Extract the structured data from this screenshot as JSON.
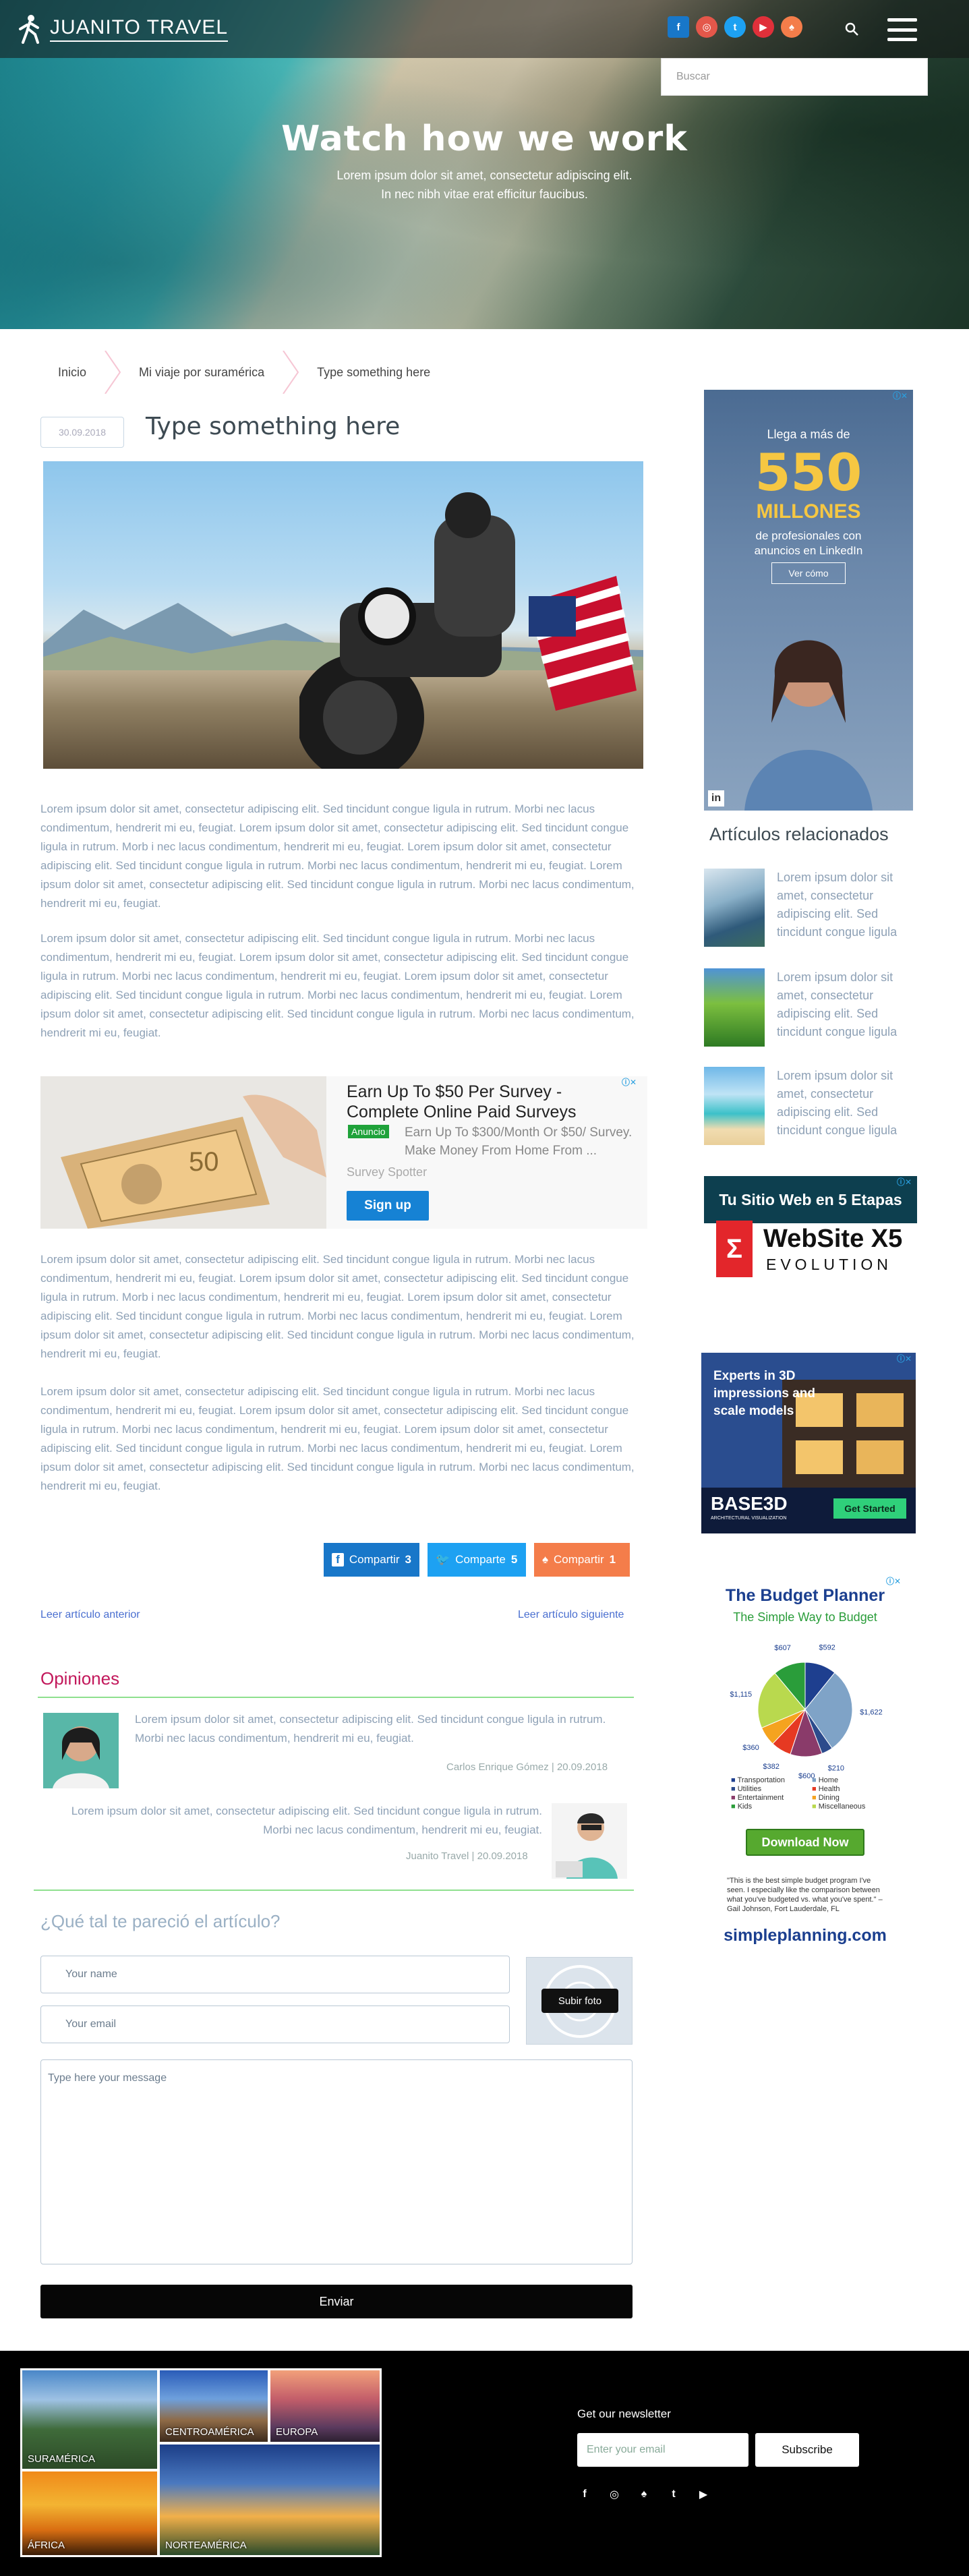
{
  "header": {
    "logo_text": "JUANITO TRAVEL",
    "search_placeholder": "Buscar"
  },
  "hero": {
    "title": "Watch how we work",
    "subtitle_line1": "Lorem ipsum dolor sit amet, consectetur adipiscing elit.",
    "subtitle_line2": "In nec nibh vitae erat efficitur faucibus."
  },
  "breadcrumb": [
    "Inicio",
    "Mi viaje por suramérica",
    "Type something here"
  ],
  "post": {
    "date": "30.09.2018",
    "title": "Type something here",
    "paragraphs": [
      "Lorem ipsum dolor sit amet, consectetur adipiscing elit. Sed tincidunt congue ligula in rutrum. Morbi nec lacus condimentum, hendrerit mi eu, feugiat. Lorem ipsum dolor sit amet, consectetur adipiscing elit. Sed tincidunt congue ligula in rutrum. Morb i nec lacus condimentum, hendrerit mi eu, feugiat. Lorem ipsum dolor sit amet, consectetur adipiscing elit. Sed tincidunt congue ligula in rutrum. Morbi nec lacus condimentum, hendrerit mi eu, feugiat. Lorem ipsum dolor sit amet, consectetur adipiscing elit. Sed tincidunt congue ligula in rutrum. Morbi nec lacus condimentum, hendrerit mi eu, feugiat.",
      "Lorem ipsum dolor sit amet, consectetur adipiscing elit. Sed tincidunt congue ligula in rutrum. Morbi nec lacus condimentum, hendrerit mi eu, feugiat. Lorem ipsum dolor sit amet, consectetur adipiscing elit. Sed tincidunt congue ligula in rutrum. Morbi nec lacus condimentum, hendrerit mi eu, feugiat. Lorem ipsum dolor sit amet, consectetur adipiscing elit. Sed tincidunt congue ligula in rutrum. Morbi nec lacus condimentum, hendrerit mi eu, feugiat. Lorem ipsum dolor sit amet, consectetur adipiscing elit. Sed tincidunt congue ligula in rutrum. Morbi nec lacus condimentum, hendrerit mi eu, feugiat.",
      "Lorem ipsum dolor sit amet, consectetur adipiscing elit. Sed tincidunt congue ligula in rutrum. Morbi nec lacus condimentum, hendrerit mi eu, feugiat. Lorem ipsum dolor sit amet, consectetur adipiscing elit. Sed tincidunt congue ligula in rutrum. Morb i nec lacus condimentum, hendrerit mi eu, feugiat. Lorem ipsum dolor sit amet, consectetur adipiscing elit. Sed tincidunt congue ligula in rutrum. Morbi nec lacus condimentum, hendrerit mi eu, feugiat. Lorem ipsum dolor sit amet, consectetur adipiscing elit. Sed tincidunt congue ligula in rutrum. Morbi nec lacus condimentum, hendrerit mi eu, feugiat.",
      "Lorem ipsum dolor sit amet, consectetur adipiscing elit. Sed tincidunt congue ligula in rutrum. Morbi nec lacus condimentum, hendrerit mi eu, feugiat. Lorem ipsum dolor sit amet, consectetur adipiscing elit. Sed tincidunt congue ligula in rutrum. Morbi nec lacus condimentum, hendrerit mi eu, feugiat. Lorem ipsum dolor sit amet, consectetur adipiscing elit. Sed tincidunt congue ligula in rutrum. Morbi nec lacus condimentum, hendrerit mi eu, feugiat. Lorem ipsum dolor sit amet, consectetur adipiscing elit. Sed tincidunt congue ligula in rutrum. Morbi nec lacus condimentum, hendrerit mi eu, feugiat."
    ]
  },
  "ad_inline": {
    "title": "Earn Up To $50 Per Survey - Complete Online Paid Surveys",
    "tag": "Anuncio",
    "description": "Earn Up To $300/Month Or $50/ Survey. Make Money From Home From ...",
    "brand": "Survey Spotter",
    "cta": "Sign up"
  },
  "share": {
    "facebook_label": "Compartir",
    "facebook_count": "3",
    "twitter_label": "Comparte",
    "twitter_count": "5",
    "snapchat_label": "Compartir",
    "snapchat_count": "1"
  },
  "article_nav": {
    "prev": "Leer artículo anterior",
    "next": "Leer artículo siguiente"
  },
  "comments": {
    "title": "Opiniones",
    "items": [
      {
        "text": "Lorem ipsum dolor sit amet, consectetur adipiscing elit. Sed tincidunt congue ligula in rutrum. Morbi nec lacus condimentum, hendrerit mi eu, feugiat.",
        "meta": "Carlos Enrique Gómez | 20.09.2018"
      },
      {
        "text": "Lorem ipsum dolor sit amet, consectetur adipiscing elit. Sed tincidunt congue ligula in rutrum. Morbi nec lacus condimentum, hendrerit mi eu, feugiat.",
        "meta": "Juanito Travel | 20.09.2018"
      }
    ]
  },
  "form": {
    "title": "¿Qué tal te pareció el artículo?",
    "name_placeholder": "Your name",
    "email_placeholder": "Your email",
    "message_placeholder": "Type here your message",
    "photo_button": "Subir foto",
    "submit": "Enviar"
  },
  "sidebar": {
    "ad_linkedin": {
      "line1": "Llega a más de",
      "number": "550",
      "line2": "MILLONES",
      "line3": "de profesionales con anuncios en LinkedIn",
      "cta": "Ver cómo"
    },
    "related_title": "Artículos relacionados",
    "related": [
      "Lorem ipsum dolor sit amet, consectetur adipiscing elit. Sed tincidunt congue ligula",
      "Lorem ipsum dolor sit amet, consectetur adipiscing elit. Sed tincidunt congue ligula",
      "Lorem ipsum dolor sit amet, consectetur adipiscing elit. Sed tincidunt congue ligula"
    ],
    "ad_website": {
      "line1": "Tu Sitio Web en 5 Etapas",
      "brand": "WebSite X5",
      "sub": "EVOLUTION"
    },
    "ad_base3d": {
      "headline": "Experts in 3D impressions and scale models",
      "brand": "BASE3D",
      "brand_sub": "ARCHITECTURAL VISUALIZATION",
      "cta": "Get Started"
    },
    "ad_budget": {
      "title": "The Budget Planner",
      "subtitle": "The Simple Way to Budget",
      "legend_left": [
        "Transportation",
        "Utilities",
        "Entertainment",
        "Kids"
      ],
      "legend_right": [
        "Home",
        "Health",
        "Dining",
        "Miscellaneous"
      ],
      "cta": "Download Now",
      "quote": "\"This is the best simple budget program I've seen. I especially like the comparison between what you've budgeted vs. what you've spent.\" – Gail Johnson, Fort Lauderdale, FL",
      "brand": "simpleplanning.com"
    }
  },
  "chart_data": {
    "type": "pie",
    "labels": [
      "$592",
      "$1,622",
      "$210",
      "$600",
      "$382",
      "$360",
      "$1,115",
      "$607"
    ],
    "values": [
      592,
      1622,
      210,
      600,
      382,
      360,
      1115,
      607
    ],
    "colors": [
      "#1e3f8f",
      "#7fa3c7",
      "#2c4b8c",
      "#8a3b6a",
      "#e63922",
      "#f5a31f",
      "#b9d94e",
      "#2a9d3a"
    ]
  },
  "footer": {
    "gallery": [
      "SURAMÉRICA",
      "CENTROAMÉRICA",
      "EUROPA",
      "ÁFRICA",
      "NORTEAMÉRICA"
    ],
    "newsletter_title": "Get our newsletter",
    "newsletter_placeholder": "Enter your email",
    "newsletter_button": "Subscribe"
  },
  "colors": {
    "accent": "#c2185b",
    "facebook": "#1877c9",
    "twitter": "#1da1f2",
    "snapchat": "#f47d4a",
    "link": "#4a6fd0",
    "body_text": "#8ea1b6"
  }
}
